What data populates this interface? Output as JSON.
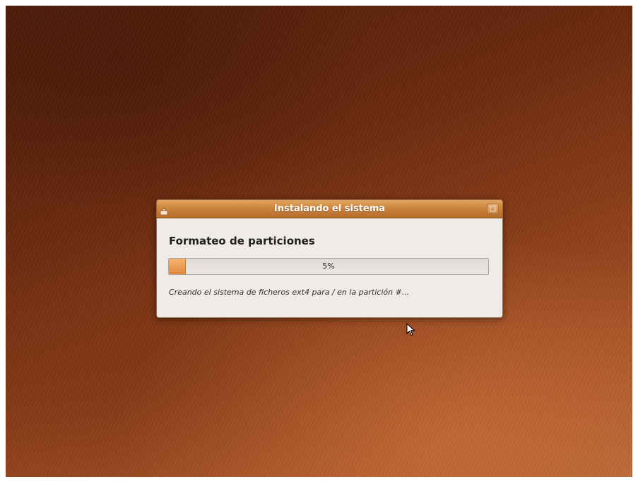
{
  "dialog": {
    "title": "Instalando el sistema",
    "heading": "Formateo de particiones",
    "progress": {
      "percent": 5,
      "label": "5%"
    },
    "status": "Creando el sistema de ficheros ext4 para / en la partición #..."
  },
  "icons": {
    "window_menu": "window-menu-icon",
    "close": "close-icon",
    "cursor": "mouse-pointer-icon"
  },
  "colors": {
    "titlebar": "#c97f38",
    "progress_fill": "#e08a3e",
    "dialog_bg": "#efebe7"
  }
}
